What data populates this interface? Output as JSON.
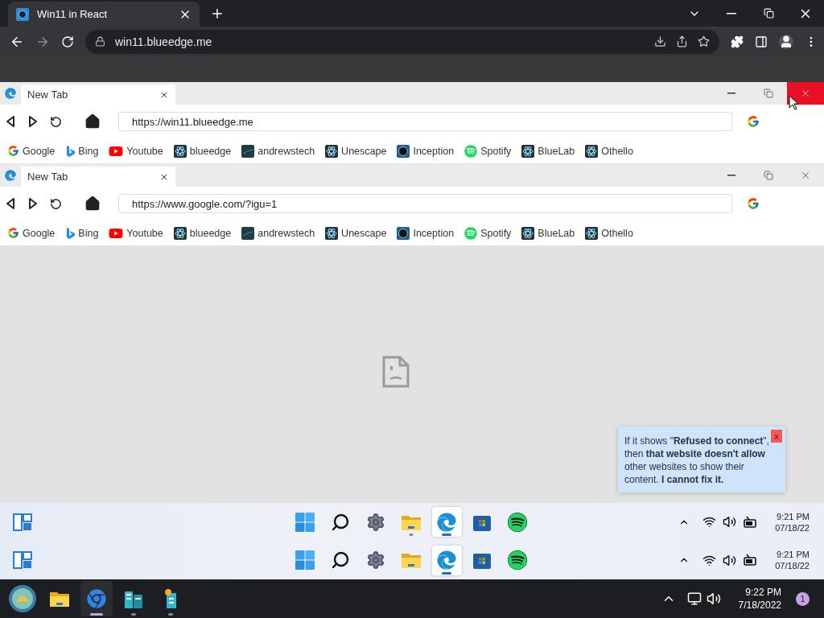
{
  "browser": {
    "tab_title": "Win11 in React",
    "address": "win11.blueedge.me"
  },
  "windows": [
    {
      "tab_title": "New Tab",
      "close_hovered": true,
      "url": "https://win11.blueedge.me",
      "bookmarks": [
        {
          "label": "Google",
          "kind": "google"
        },
        {
          "label": "Bing",
          "kind": "bing"
        },
        {
          "label": "Youtube",
          "kind": "youtube"
        },
        {
          "label": "blueedge",
          "kind": "react"
        },
        {
          "label": "andrewstech",
          "kind": "andrewstech"
        },
        {
          "label": "Unescape",
          "kind": "react"
        },
        {
          "label": "Inception",
          "kind": "inception"
        },
        {
          "label": "Spotify",
          "kind": "spotify"
        },
        {
          "label": "BlueLab",
          "kind": "react"
        },
        {
          "label": "Othello",
          "kind": "react"
        }
      ]
    },
    {
      "tab_title": "New Tab",
      "close_hovered": false,
      "url": "https://www.google.com/?igu=1",
      "bookmarks": [
        {
          "label": "Google",
          "kind": "google"
        },
        {
          "label": "Bing",
          "kind": "bing"
        },
        {
          "label": "Youtube",
          "kind": "youtube"
        },
        {
          "label": "blueedge",
          "kind": "react"
        },
        {
          "label": "andrewstech",
          "kind": "andrewstech"
        },
        {
          "label": "Unescape",
          "kind": "react"
        },
        {
          "label": "Inception",
          "kind": "inception"
        },
        {
          "label": "Spotify",
          "kind": "spotify"
        },
        {
          "label": "BlueLab",
          "kind": "react"
        },
        {
          "label": "Othello",
          "kind": "react"
        }
      ]
    }
  ],
  "tooltip": {
    "text": "If it shows \"**Refused to connect**\", then **that website doesn't allow** other websites to show their content. **I cannot fix it.**",
    "close": "x"
  },
  "taskbars": [
    {
      "time": "9:21 PM",
      "date": "07/18/22",
      "apps": [
        {
          "kind": "start",
          "selected": false,
          "running": false
        },
        {
          "kind": "search",
          "selected": false,
          "running": false
        },
        {
          "kind": "settings",
          "selected": false,
          "running": false
        },
        {
          "kind": "explorer",
          "selected": false,
          "running": true
        },
        {
          "kind": "edge",
          "selected": true,
          "running": true
        },
        {
          "kind": "store",
          "selected": false,
          "running": false
        },
        {
          "kind": "spotify",
          "selected": false,
          "running": false
        }
      ]
    },
    {
      "time": "9:21 PM",
      "date": "07/18/22",
      "apps": [
        {
          "kind": "start",
          "selected": false,
          "running": false
        },
        {
          "kind": "search",
          "selected": false,
          "running": false
        },
        {
          "kind": "settings",
          "selected": false,
          "running": false
        },
        {
          "kind": "explorer",
          "selected": false,
          "running": false
        },
        {
          "kind": "edge",
          "selected": true,
          "running": true
        },
        {
          "kind": "store",
          "selected": false,
          "running": false
        },
        {
          "kind": "spotify",
          "selected": false,
          "running": false
        }
      ]
    }
  ],
  "host_taskbar": {
    "apps": [
      {
        "kind": "shell",
        "selected": false,
        "running": false
      },
      {
        "kind": "explorer",
        "selected": false,
        "running": false
      },
      {
        "kind": "chrome",
        "selected": true,
        "running": true
      },
      {
        "kind": "buildings",
        "selected": false,
        "running": true
      },
      {
        "kind": "tower",
        "selected": false,
        "running": true
      }
    ],
    "time": "9:22 PM",
    "date": "7/18/2022",
    "badge": "1"
  }
}
